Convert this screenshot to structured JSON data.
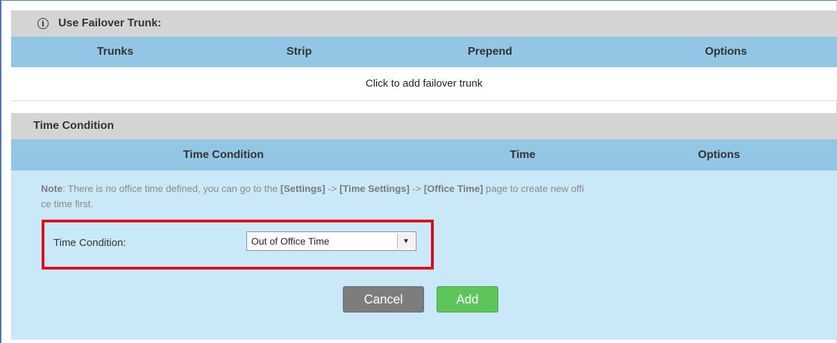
{
  "failover": {
    "title": "Use Failover Trunk:",
    "columns": [
      "Trunks",
      "Strip",
      "Prepend",
      "Options"
    ],
    "add_link": "Click to add failover trunk"
  },
  "time_condition": {
    "title": "Time Condition",
    "columns": [
      "Time Condition",
      "Time",
      "Options"
    ],
    "note_label": "Note",
    "note_text_1": ": There is no office time defined, you can go to the ",
    "note_link_settings": "[Settings]",
    "note_sep_1": " -> ",
    "note_link_time_settings": "[Time Settings]",
    "note_sep_2": " -> ",
    "note_link_office_time": "[Office Time]",
    "note_text_2": " page to create new offi",
    "note_text_3": "ce time first.",
    "field_label": "Time Condition:",
    "select_value": "Out of Office Time",
    "cancel_label": "Cancel",
    "add_label": "Add"
  },
  "colors": {
    "section_bar": "#d4d4d4",
    "table_header": "#92c6e4",
    "panel_bg": "#c9e9f8",
    "highlight": "#e4001b",
    "cancel": "#7d7d7d",
    "add": "#5dc55a"
  },
  "icons": {
    "info": "info-circle-icon",
    "dropdown": "triangle-down-icon"
  }
}
